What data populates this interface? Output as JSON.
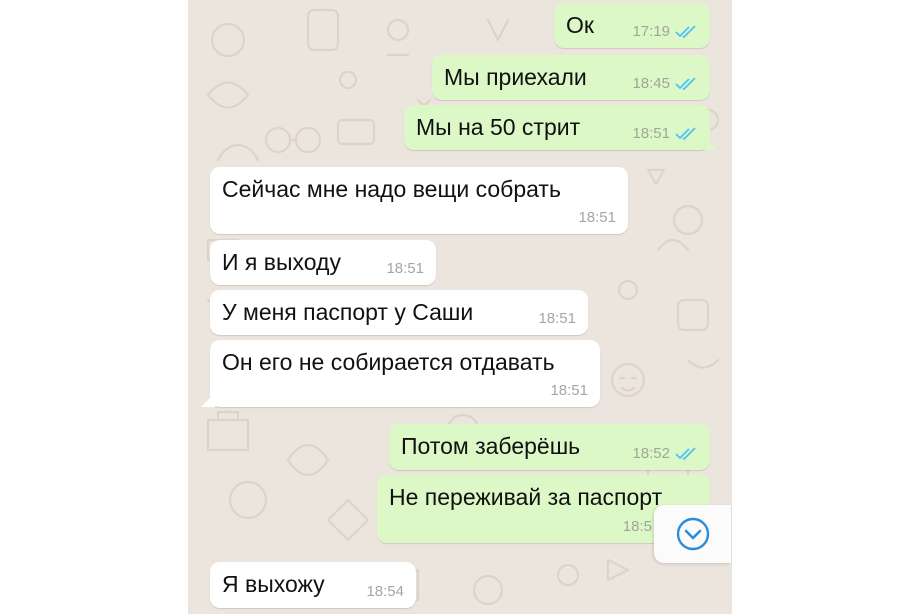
{
  "theme": {
    "chat_background": "#ece5dd",
    "outgoing_bubble": "#dcf8c6",
    "incoming_bubble": "#ffffff",
    "read_ticks_color": "#4fc3f7"
  },
  "messages": [
    {
      "direction": "out",
      "text": "Ок",
      "time": "17:19",
      "status": "read"
    },
    {
      "direction": "out",
      "text": "Мы приехали",
      "time": "18:45",
      "status": "read"
    },
    {
      "direction": "out",
      "text": "Мы на 50 стрит",
      "time": "18:51",
      "status": "read"
    },
    {
      "direction": "in",
      "text": "Сейчас мне надо вещи собрать",
      "time": "18:51"
    },
    {
      "direction": "in",
      "text": "И я выходу",
      "time": "18:51"
    },
    {
      "direction": "in",
      "text": "У меня паспорт у Саши",
      "time": "18:51"
    },
    {
      "direction": "in",
      "text": "Он его не собирается отдавать",
      "time": "18:51"
    },
    {
      "direction": "out",
      "text": "Потом заберёшь",
      "time": "18:52",
      "status": "read"
    },
    {
      "direction": "out",
      "text": "Не переживай за паспорт",
      "time": "18:5"
    },
    {
      "direction": "in",
      "text": "Я выхожу",
      "time": "18:54"
    }
  ],
  "scroll_button": {
    "icon": "chevron-down-circle-icon"
  }
}
